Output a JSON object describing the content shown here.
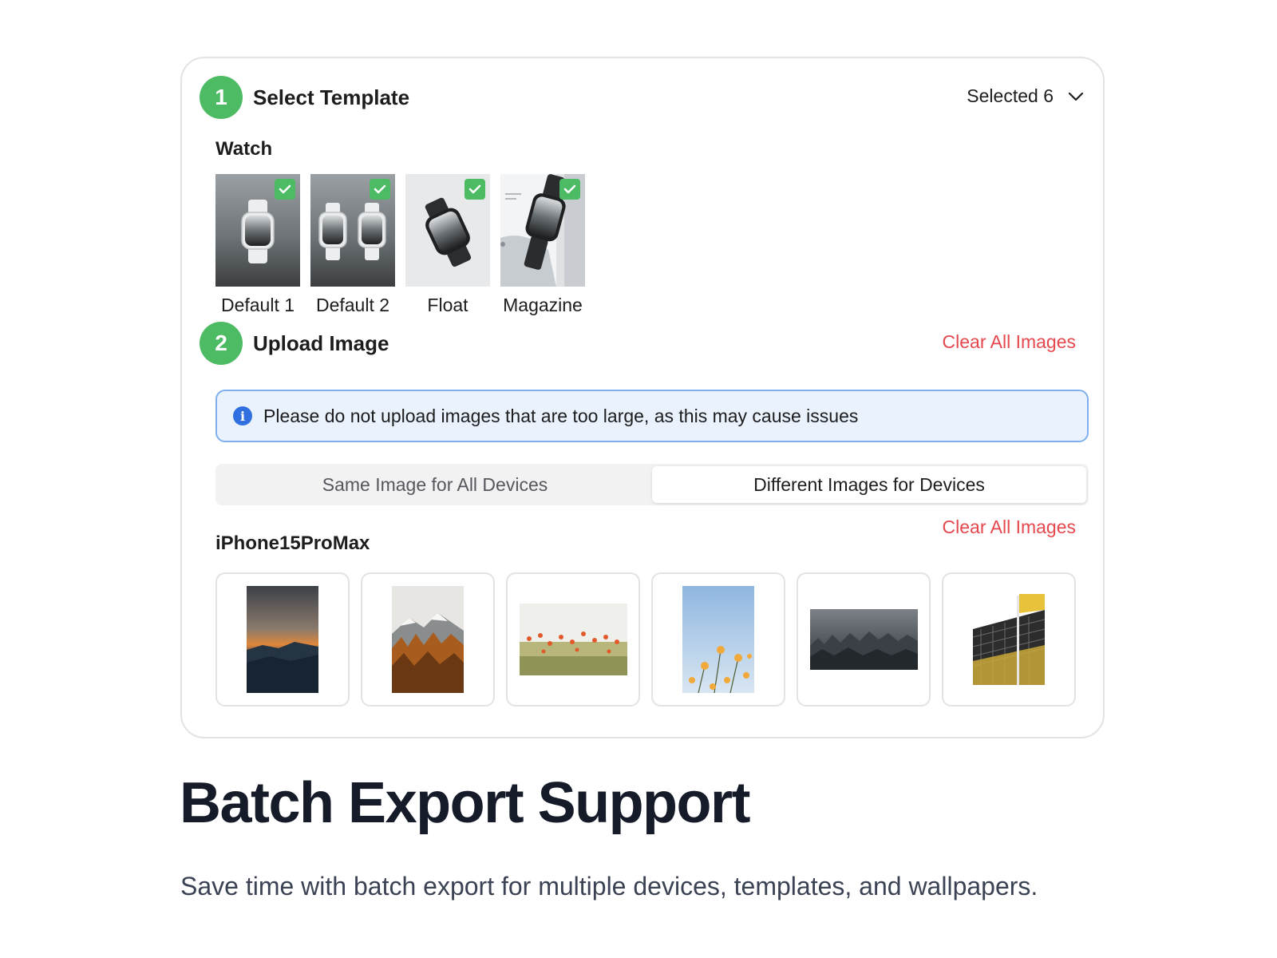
{
  "step1": {
    "number": "1",
    "title": "Select Template",
    "selected_label": "Selected 6",
    "group": "Watch",
    "templates": [
      {
        "label": "Default 1",
        "checked": true
      },
      {
        "label": "Default 2",
        "checked": true
      },
      {
        "label": "Float",
        "checked": true
      },
      {
        "label": "Magazine",
        "checked": true
      }
    ]
  },
  "step2": {
    "number": "2",
    "title": "Upload Image",
    "clear_label": "Clear All Images",
    "info_message": "Please do not upload images that are too large, as this may cause issues",
    "segment_same": "Same Image for All Devices",
    "segment_different": "Different Images for Devices",
    "active_segment": "Different Images for Devices",
    "device_name": "iPhone15ProMax",
    "device_clear_label": "Clear All Images",
    "images": [
      "sunset-mountains",
      "autumn-forest-mountain",
      "poppy-field",
      "yellow-flowers-sky",
      "misty-forest",
      "gold-building"
    ]
  },
  "footer": {
    "headline": "Batch Export Support",
    "subheadline": "Save time with batch export for multiple devices, templates, and wallpapers."
  },
  "colors": {
    "accent_green": "#4cbb64",
    "danger_red": "#e5484d",
    "info_blue": "#2f6fe0",
    "info_bg": "#eaf3fd"
  }
}
